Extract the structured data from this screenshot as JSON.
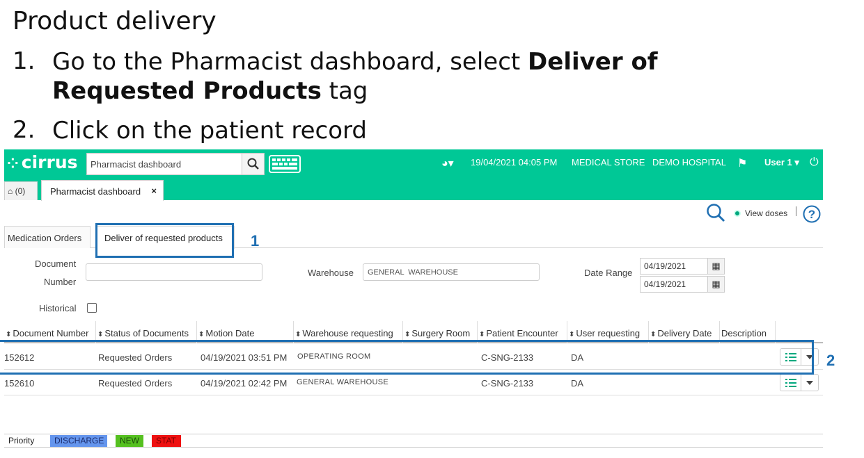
{
  "slide": {
    "title": "Product delivery",
    "step1_num": "1.",
    "step1_text_a": "Go to the Pharmacist dashboard, select ",
    "step1_bold": "Deliver of Requested Products",
    "step1_text_b": " tag",
    "step2_num": "2.",
    "step2_text": "Click on the patient record"
  },
  "app": {
    "logo": "cirrus",
    "search_value": "Pharmacist dashboard",
    "datetime": "19/04/2021 04:05 PM",
    "store": "MEDICAL STORE",
    "hospital": "DEMO HOSPITAL",
    "user": "User 1",
    "home_count": "(0)",
    "page_tab": "Pharmacist dashboard",
    "page_tab_close": "×",
    "view_doses": "View doses",
    "accent": "#00c896"
  },
  "subtabs": [
    "Medication Orders",
    "Deliver of requested products"
  ],
  "filters": {
    "doc_label_1": "Document",
    "doc_label_2": "Number",
    "doc_value": "",
    "warehouse_label": "Warehouse",
    "warehouse_value": "GENERAL  WAREHOUSE",
    "date_label": "Date Range",
    "date_from": "04/19/2021",
    "date_to": "04/19/2021",
    "historical_label": "Historical"
  },
  "table": {
    "headers": [
      "Document Number",
      "Status of Documents",
      "Motion Date",
      "Warehouse requesting",
      "Surgery Room",
      "Patient Encounter",
      "User requesting",
      "Delivery Date",
      "Description"
    ],
    "rows": [
      {
        "doc": "152612",
        "status": "Requested Orders",
        "date": "04/19/2021 03:51 PM",
        "warehouse": "OPERATING ROOM",
        "surgery": "",
        "encounter": "C-SNG-2133",
        "user": "DA",
        "delivery": "",
        "description": ""
      },
      {
        "doc": "152610",
        "status": "Requested Orders",
        "date": "04/19/2021 02:42 PM",
        "warehouse": "GENERAL  WAREHOUSE",
        "surgery": "",
        "encounter": "C-SNG-2133",
        "user": "DA",
        "delivery": "",
        "description": ""
      }
    ]
  },
  "legend": {
    "label": "Priority",
    "items": [
      {
        "text": "DISCHARGE",
        "bg": "#6495ed",
        "fg": "#1a2a6a"
      },
      {
        "text": "NEW",
        "bg": "#55c020",
        "fg": "#1a4a0a"
      },
      {
        "text": "STAT",
        "bg": "#ee1111",
        "fg": "#7a0000"
      }
    ]
  },
  "callouts": {
    "one": "1",
    "two": "2",
    "color": "#1f6fb2"
  }
}
